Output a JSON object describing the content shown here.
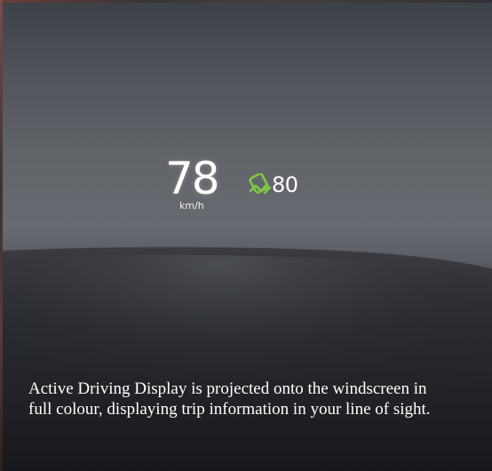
{
  "hud": {
    "speed": "78",
    "speed_unit": "km/h",
    "speed_limit": "80",
    "limit_icon": "speed-sign-icon",
    "limit_icon_color": "#7fc843"
  },
  "caption": {
    "text": "Active Driving Display is projected onto the windscreen in full colour, displaying trip information in your line of sight."
  },
  "colors": {
    "hud_text": "#ffffff",
    "dash_dark": "#16181b"
  }
}
